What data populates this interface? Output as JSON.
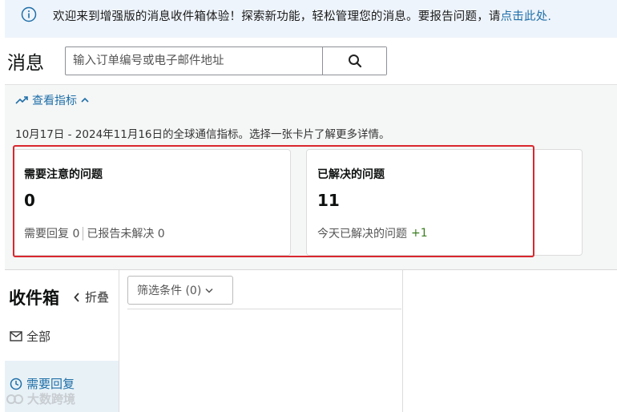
{
  "banner": {
    "text": "欢迎来到增强版的消息收件箱体验！探索新功能，轻松管理您的消息。要报告问题，请",
    "link": "点击此处."
  },
  "header": {
    "title": "消息",
    "search_placeholder": "输入订单编号或电子邮件地址"
  },
  "metrics": {
    "toggle_label": "查看指标",
    "description": "10月17日 - 2024年11月16日的全球通信指标。选择一张卡片了解更多详情。",
    "cards": [
      {
        "title": "需要注意的问题",
        "value": "0",
        "sub_a": "需要回复 0",
        "sub_b": "已报告未解决 0"
      },
      {
        "title": "已解决的问题",
        "value": "11",
        "sub_a": "今天已解决的问题",
        "delta": "+1"
      }
    ]
  },
  "inbox": {
    "title": "收件箱",
    "collapse_label": "折叠",
    "nav": [
      {
        "label": "全部",
        "icon": "mail-icon"
      },
      {
        "label": "需要回复",
        "icon": "clock-icon"
      }
    ],
    "filter_label": "筛选条件 (0)"
  },
  "watermark": "大数跨境",
  "colors": {
    "link": "#1f6fa8",
    "highlight": "#d9272e",
    "positive": "#3a7d1e",
    "banner_bg": "#eef4fb"
  }
}
